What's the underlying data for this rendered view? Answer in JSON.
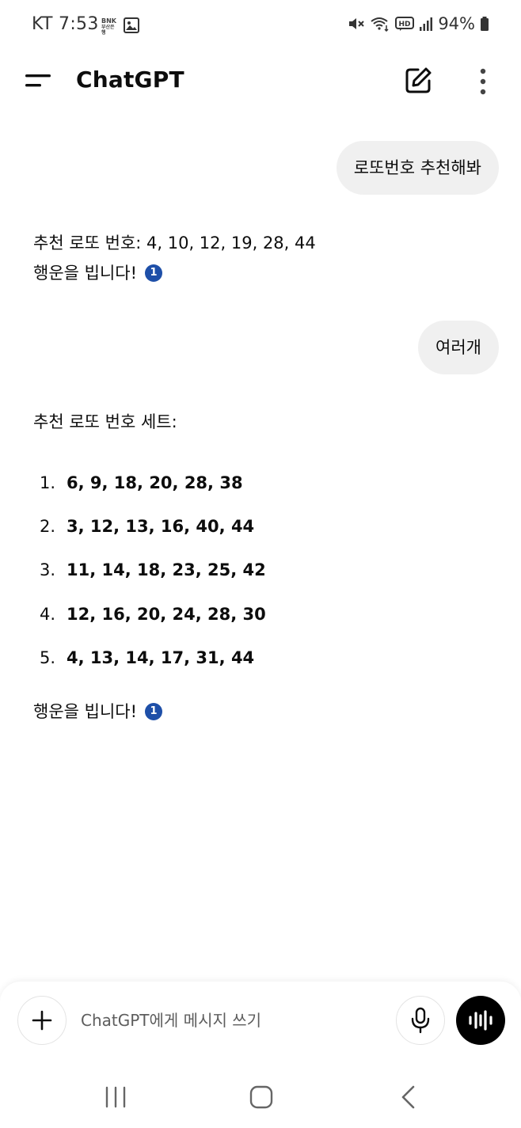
{
  "status_bar": {
    "carrier_time": "KT 7:53",
    "bank_label_top": "BNK",
    "bank_label_bottom": "부산은행",
    "battery": "94%"
  },
  "header": {
    "title": "ChatGPT"
  },
  "messages": {
    "user_1": "로또번호 추천해봐",
    "assistant_1": {
      "line_1": "추천 로또 번호: 4, 10, 12, 19, 28, 44",
      "line_2": "행운을 빕니다!",
      "citation": "1"
    },
    "user_2": "여러개",
    "assistant_2": {
      "heading": "추천 로또 번호 세트:",
      "sets": [
        {
          "index": "1.",
          "numbers": "6, 9, 18, 20, 28, 38"
        },
        {
          "index": "2.",
          "numbers": "3, 12, 13, 16, 40, 44"
        },
        {
          "index": "3.",
          "numbers": "11, 14, 18, 23, 25, 42"
        },
        {
          "index": "4.",
          "numbers": "12, 16, 20, 24, 28, 30"
        },
        {
          "index": "5.",
          "numbers": "4, 13, 14, 17, 31, 44"
        }
      ],
      "footer": "행운을 빕니다!",
      "citation": "1"
    }
  },
  "composer": {
    "placeholder": "ChatGPT에게 메시지 쓰기",
    "value": ""
  },
  "icons": {
    "menu": "menu-icon",
    "compose": "edit-icon",
    "more": "more-vertical-icon",
    "plus": "plus-icon",
    "mic": "microphone-icon",
    "voice": "voice-mode-icon"
  },
  "colors": {
    "accent_citation": "#1e4fa8",
    "user_bubble": "#f0f0f0",
    "voice_button": "#000000"
  }
}
